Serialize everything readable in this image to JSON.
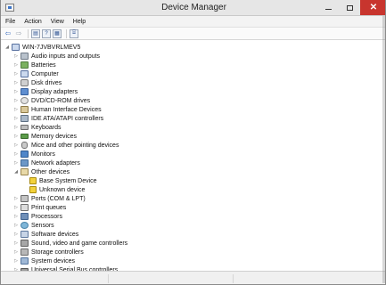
{
  "window": {
    "title": "Device Manager"
  },
  "menu": [
    "File",
    "Action",
    "View",
    "Help"
  ],
  "toolbar": {
    "buttons": [
      {
        "icon": "back-arrow-icon",
        "glyph": "⇦"
      },
      {
        "icon": "forward-arrow-icon",
        "glyph": "⇨"
      },
      {
        "icon": "show-hide-console-tree-icon",
        "glyph": "▤"
      },
      {
        "icon": "help-icon",
        "glyph": "?"
      },
      {
        "icon": "properties-icon",
        "glyph": "▦"
      },
      {
        "icon": "scan-hardware-icon",
        "glyph": "⌸"
      }
    ]
  },
  "tree": {
    "root": "WIN-7JVBVRLMEV5",
    "items": [
      {
        "label": "Audio inputs and outputs",
        "icon": "device",
        "expand": "▷",
        "depth": 1
      },
      {
        "label": "Batteries",
        "icon": "battery",
        "expand": "▷",
        "depth": 1
      },
      {
        "label": "Computer",
        "icon": "computer",
        "expand": "▷",
        "depth": 1
      },
      {
        "label": "Disk drives",
        "icon": "disk",
        "expand": "▷",
        "depth": 1
      },
      {
        "label": "Display adapters",
        "icon": "display",
        "expand": "▷",
        "depth": 1
      },
      {
        "label": "DVD/CD-ROM drives",
        "icon": "cd",
        "expand": "▷",
        "depth": 1
      },
      {
        "label": "Human Interface Devices",
        "icon": "hid",
        "expand": "▷",
        "depth": 1
      },
      {
        "label": "IDE ATA/ATAPI controllers",
        "icon": "ide",
        "expand": "▷",
        "depth": 1
      },
      {
        "label": "Keyboards",
        "icon": "keyboard",
        "expand": "▷",
        "depth": 1
      },
      {
        "label": "Memory devices",
        "icon": "memory",
        "expand": "▷",
        "depth": 1
      },
      {
        "label": "Mice and other pointing devices",
        "icon": "mouse",
        "expand": "▷",
        "depth": 1
      },
      {
        "label": "Monitors",
        "icon": "monitor",
        "expand": "▷",
        "depth": 1
      },
      {
        "label": "Network adapters",
        "icon": "network",
        "expand": "▷",
        "depth": 1
      },
      {
        "label": "Other devices",
        "icon": "other",
        "expand": "◢",
        "depth": 1
      },
      {
        "label": "Base System Device",
        "icon": "warn",
        "expand": "",
        "depth": 2
      },
      {
        "label": "Unknown device",
        "icon": "warn",
        "expand": "",
        "depth": 2
      },
      {
        "label": "Ports (COM & LPT)",
        "icon": "port",
        "expand": "▷",
        "depth": 1
      },
      {
        "label": "Print queues",
        "icon": "print",
        "expand": "▷",
        "depth": 1
      },
      {
        "label": "Processors",
        "icon": "cpu",
        "expand": "▷",
        "depth": 1
      },
      {
        "label": "Sensors",
        "icon": "sensor",
        "expand": "▷",
        "depth": 1
      },
      {
        "label": "Software devices",
        "icon": "software",
        "expand": "▷",
        "depth": 1
      },
      {
        "label": "Sound, video and game controllers",
        "icon": "sound",
        "expand": "▷",
        "depth": 1
      },
      {
        "label": "Storage controllers",
        "icon": "storage",
        "expand": "▷",
        "depth": 1
      },
      {
        "label": "System devices",
        "icon": "system",
        "expand": "▷",
        "depth": 1
      },
      {
        "label": "Universal Serial Bus controllers",
        "icon": "usb",
        "expand": "▷",
        "depth": 1
      }
    ]
  },
  "colors": {
    "close_button": "#c8352e",
    "titlebar": "#e6e6e6"
  }
}
